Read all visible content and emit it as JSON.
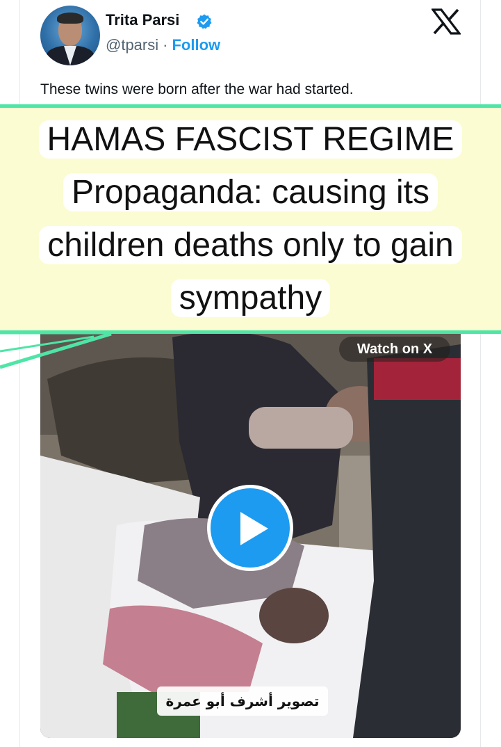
{
  "tweet": {
    "author_name": "Trita Parsi",
    "handle": "@tparsi",
    "separator": "·",
    "follow_label": "Follow",
    "text": "These twins were born after the war had started."
  },
  "overlay_banner": {
    "line1": "HAMAS FASCIST REGIME",
    "line2": "Propaganda: causing its",
    "line3": "children deaths only to gain",
    "line4": "sympathy"
  },
  "video": {
    "watch_label": "Watch on X",
    "caption": "تصوير أشرف أبو عمرة"
  },
  "colors": {
    "accent": "#1d9bf0",
    "banner_bg": "#fbfcd1",
    "banner_border": "#4ee5a6",
    "text_primary": "#0f1419",
    "text_secondary": "#536471"
  },
  "icons": {
    "brand": "x-logo-icon",
    "verified": "verified-badge-icon",
    "play": "play-icon"
  }
}
